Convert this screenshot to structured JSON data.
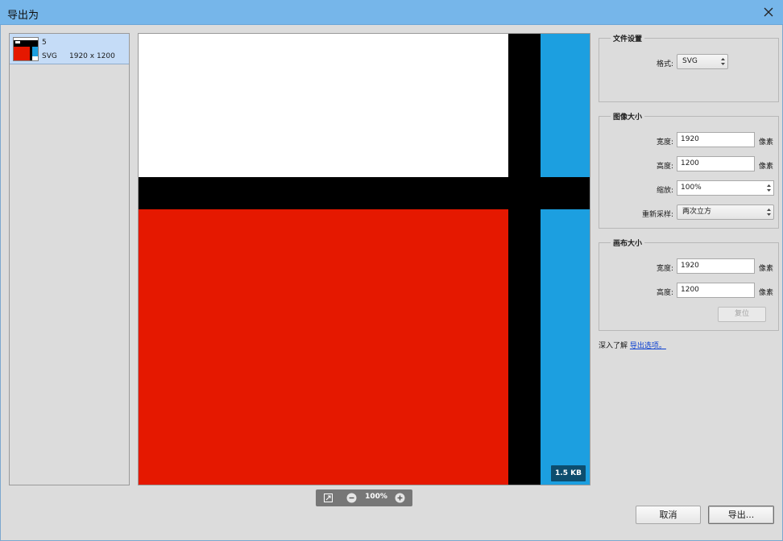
{
  "window": {
    "title": "导出为"
  },
  "file_list": {
    "items": [
      {
        "name": "5",
        "type": "SVG",
        "dims": "1920 x 1200"
      }
    ]
  },
  "preview": {
    "file_size_badge": "1.5 KB",
    "colors": {
      "white": "#ffffff",
      "black": "#000000",
      "red": "#e51800",
      "blue": "#1c9fe0"
    }
  },
  "zoom": {
    "value": "100%"
  },
  "file_settings": {
    "title": "文件设置",
    "format_label": "格式:",
    "format_value": "SVG"
  },
  "image_size": {
    "title": "图像大小",
    "width_label": "宽度:",
    "width_value": "1920",
    "width_unit": "像素",
    "height_label": "高度:",
    "height_value": "1200",
    "height_unit": "像素",
    "scale_label": "缩放:",
    "scale_value": "100%",
    "resample_label": "重新采样:",
    "resample_value": "两次立方"
  },
  "canvas_size": {
    "title": "画布大小",
    "width_label": "宽度:",
    "width_value": "1920",
    "width_unit": "像素",
    "height_label": "高度:",
    "height_value": "1200",
    "height_unit": "像素",
    "reset_label": "复位"
  },
  "learn_more": {
    "prefix": "深入了解",
    "link": "导出选项。"
  },
  "buttons": {
    "cancel": "取消",
    "export": "导出..."
  }
}
